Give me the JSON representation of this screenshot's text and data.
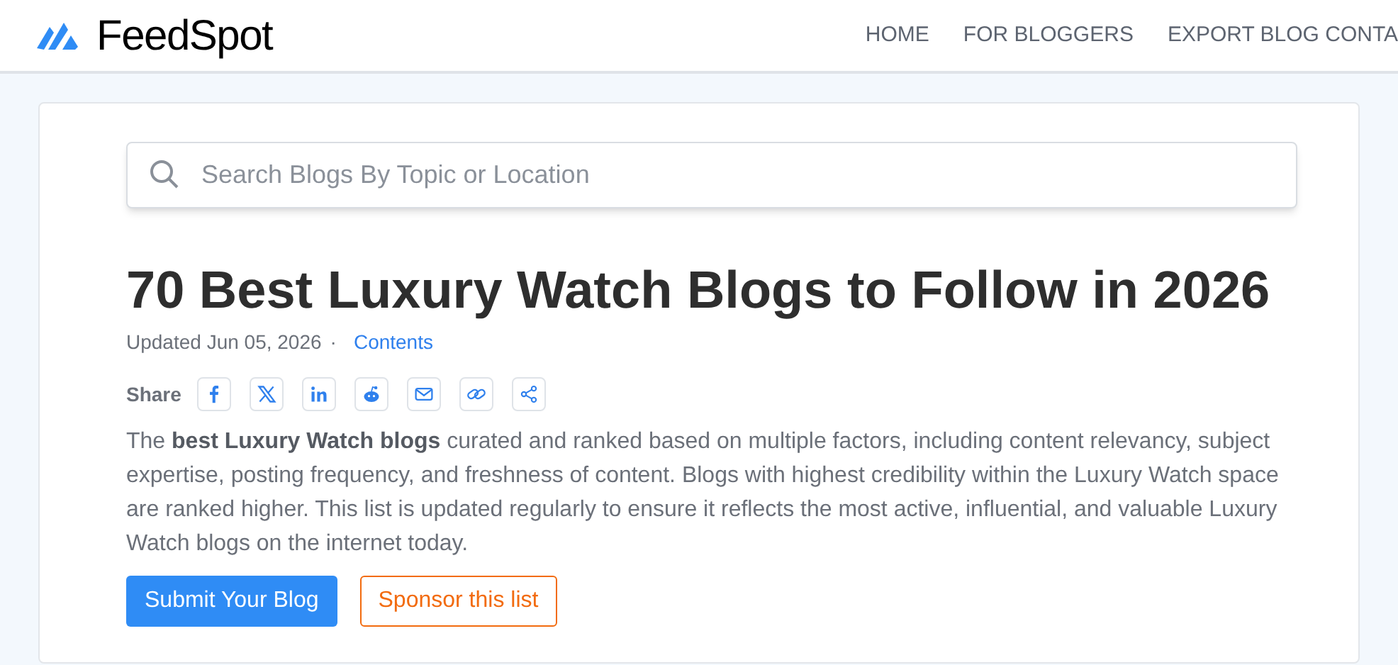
{
  "header": {
    "logo": "FeedSpot",
    "nav": [
      "HOME",
      "FOR BLOGGERS",
      "EXPORT BLOG CONTA"
    ]
  },
  "search": {
    "placeholder": "Search Blogs By Topic or Location"
  },
  "title": "70 Best Luxury Watch Blogs to Follow in 2026",
  "updated": "Updated Jun 05, 2026",
  "separator": "·",
  "contents_link": "Contents",
  "share": {
    "label": "Share",
    "buttons": [
      {
        "kind": "facebook"
      },
      {
        "kind": "x"
      },
      {
        "kind": "linkedin"
      },
      {
        "kind": "reddit"
      },
      {
        "kind": "email"
      },
      {
        "kind": "link"
      },
      {
        "kind": "share"
      }
    ]
  },
  "description": "The **best Luxury Watch blogs** curated and ranked based on multiple factors, including content relevancy, subject expertise, posting frequency, and freshness of content. Blogs with highest credibility within the Luxury Watch space are ranked higher. This list is updated regularly to ensure it reflects the most active, influential, and valuable Luxury Watch blogs on the internet today.",
  "buttons": [
    {
      "label": "Submit Your Blog",
      "kind": "primary"
    },
    {
      "label": "Sponsor this list",
      "kind": "outline"
    }
  ]
}
